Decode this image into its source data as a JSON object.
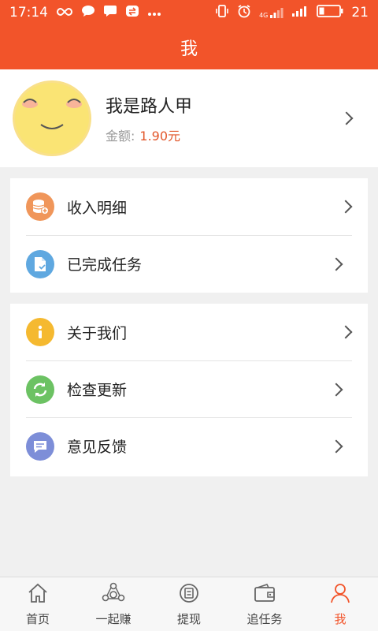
{
  "status_bar": {
    "time": "17:14",
    "left_icons": [
      "infinity-icon",
      "chat-bubble-icon",
      "message-icon",
      "sync-icon",
      "more-dots-icon"
    ],
    "right_icons": [
      "vibrate-icon",
      "alarm-icon",
      "4g-signal-icon",
      "signal-icon",
      "battery-icon"
    ],
    "network_label": "4G",
    "battery": "21"
  },
  "header": {
    "title": "我"
  },
  "profile": {
    "name": "我是路人甲",
    "balance_label": "金额:",
    "balance_value": "1.90元"
  },
  "menu_groups": [
    {
      "items": [
        {
          "label": "收入明细",
          "icon": "coins-icon",
          "color": "#f0965a"
        },
        {
          "label": "已完成任务",
          "icon": "document-check-icon",
          "color": "#5fa8e0"
        }
      ]
    },
    {
      "items": [
        {
          "label": "关于我们",
          "icon": "info-icon",
          "color": "#f5b930"
        },
        {
          "label": "检查更新",
          "icon": "refresh-icon",
          "color": "#6cc263"
        },
        {
          "label": "意见反馈",
          "icon": "feedback-icon",
          "color": "#7d8ed8"
        }
      ]
    }
  ],
  "tab_bar": {
    "tabs": [
      {
        "label": "首页",
        "icon": "home-icon",
        "active": false
      },
      {
        "label": "一起赚",
        "icon": "share-earn-icon",
        "active": false
      },
      {
        "label": "提现",
        "icon": "withdraw-icon",
        "active": false
      },
      {
        "label": "追任务",
        "icon": "wallet-icon",
        "active": false
      },
      {
        "label": "我",
        "icon": "profile-icon",
        "active": true
      }
    ]
  },
  "colors": {
    "accent": "#f2542a",
    "amount": "#e2572b",
    "background": "#f0f0f0"
  }
}
